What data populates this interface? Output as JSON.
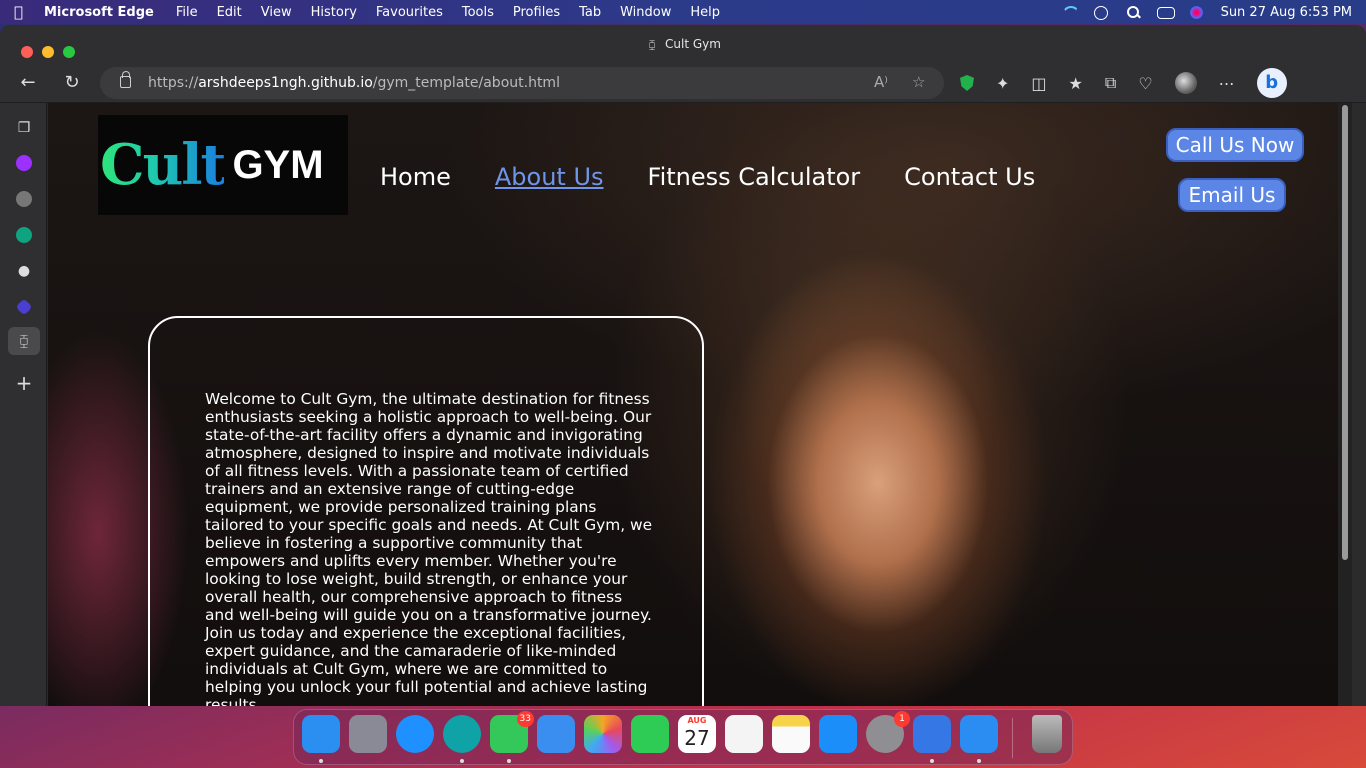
{
  "menubar": {
    "app_name": "Microsoft Edge",
    "items": [
      "File",
      "Edit",
      "View",
      "History",
      "Favourites",
      "Tools",
      "Profiles",
      "Tab",
      "Window",
      "Help"
    ],
    "clock": "Sun 27 Aug  6:53 PM",
    "status_icons": [
      "wifi-icon",
      "now-playing-icon",
      "spotlight-search-icon",
      "control-center-icon",
      "siri-icon"
    ]
  },
  "browser": {
    "tab_title": "Cult Gym",
    "url_prefix": "https://",
    "url_host": "arshdeeps1ngh.github.io",
    "url_path": "/gym_template/about.html",
    "read_aloud_glyph": "A⁾",
    "favorite_glyph": "☆",
    "toolbar_glyphs": {
      "back": "←",
      "refresh": "↻",
      "extensions": "✦",
      "split": "◫",
      "favorites": "★",
      "collections": "⧉",
      "performance": "♡",
      "menu": "⋯",
      "bing": "b"
    }
  },
  "sidebar": {
    "icons": [
      "tab-actions-icon",
      "extension-purple-icon",
      "extension-gray-icon",
      "chatgpt-icon",
      "github-icon",
      "extension-blue-icon",
      "cult-gym-tab-icon",
      "add-icon"
    ],
    "glyphs": {
      "tabs": "❐",
      "github": "●",
      "gym": "⧮",
      "add": "+"
    }
  },
  "site": {
    "logo_word": "Cult",
    "logo_gym": "GYM",
    "nav": [
      {
        "label": "Home"
      },
      {
        "label": "About Us",
        "current": true
      },
      {
        "label": "Fitness Calculator"
      },
      {
        "label": "Contact Us"
      }
    ],
    "call_button": "Call Us Now",
    "email_button": "Email Us",
    "about_text": "Welcome to Cult Gym, the ultimate destination for fitness enthusiasts seeking a holistic approach to well-being. Our state-of-the-art facility offers a dynamic and invigorating atmosphere, designed to inspire and motivate individuals of all fitness levels. With a passionate team of certified trainers and an extensive range of cutting-edge equipment, we provide personalized training plans tailored to your specific goals and needs. At Cult Gym, we believe in fostering a supportive community that empowers and uplifts every member. Whether you're looking to lose weight, build strength, or enhance your overall health, our comprehensive approach to fitness and well-being will guide you on a transformative journey. Join us today and experience the exceptional facilities, expert guidance, and the camaraderie of like-minded individuals at Cult Gym, where we are committed to helping you unlock your full potential and achieve lasting results."
  },
  "dock": {
    "apps": [
      {
        "name": "finder",
        "color": "#2a8ff0",
        "running": true
      },
      {
        "name": "launchpad",
        "color": "#8a8a96"
      },
      {
        "name": "safari",
        "color": "#1e90ff"
      },
      {
        "name": "edge",
        "color": "#0fa3a8",
        "running": true
      },
      {
        "name": "messages",
        "color": "#34c759",
        "badge": "33",
        "running": true
      },
      {
        "name": "mail",
        "color": "#3a8ef0"
      },
      {
        "name": "photos",
        "color": "#f5a623"
      },
      {
        "name": "facetime",
        "color": "#2ecc55"
      },
      {
        "name": "calendar",
        "color": "#ffffff",
        "month": "AUG",
        "day": "27"
      },
      {
        "name": "reminders",
        "color": "#f4f4f4"
      },
      {
        "name": "notes",
        "color": "#f7d34a"
      },
      {
        "name": "app-store",
        "color": "#1c8ef9"
      },
      {
        "name": "system-settings",
        "color": "#8e8e93",
        "badge": "1"
      },
      {
        "name": "xcode",
        "color": "#3578e5",
        "running": true
      },
      {
        "name": "simulator",
        "color": "#2b8cf2",
        "running": true
      },
      {
        "name": "trash",
        "color": "#9a9a9a"
      }
    ]
  }
}
